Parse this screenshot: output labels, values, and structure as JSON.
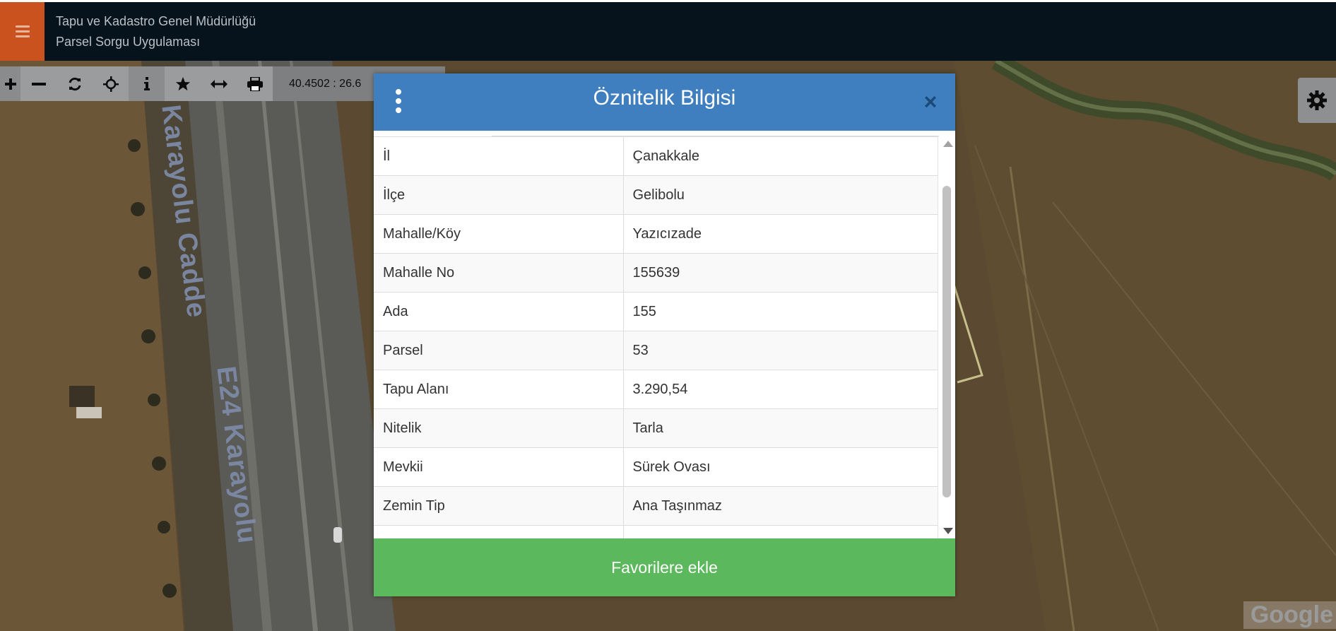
{
  "header": {
    "title_line1": "Tapu ve Kadastro Genel Müdürlüğü",
    "title_line2": "Parsel Sorgu Uygulaması"
  },
  "toolbar": {
    "coordinates": "40.4502 : 26.6",
    "buttons": [
      {
        "name": "zoom-in",
        "icon": "plus-icon"
      },
      {
        "name": "zoom-out",
        "icon": "minus-icon"
      },
      {
        "name": "refresh",
        "icon": "refresh-icon"
      },
      {
        "name": "locate",
        "icon": "crosshair-icon"
      },
      {
        "name": "info",
        "icon": "info-icon"
      },
      {
        "name": "favorite",
        "icon": "star-icon"
      },
      {
        "name": "measure",
        "icon": "arrows-horizontal-icon"
      },
      {
        "name": "print",
        "icon": "print-icon"
      }
    ]
  },
  "map": {
    "road_label_1": "Karayolu Cadde",
    "road_label_2": "E24 Karayolu",
    "attribution": "Google"
  },
  "modal": {
    "title": "Öznitelik Bilgisi",
    "close": "×",
    "rows": [
      {
        "key": "İl",
        "value": "Çanakkale"
      },
      {
        "key": "İlçe",
        "value": "Gelibolu"
      },
      {
        "key": "Mahalle/Köy",
        "value": "Yazıcızade"
      },
      {
        "key": "Mahalle No",
        "value": "155639"
      },
      {
        "key": "Ada",
        "value": "155"
      },
      {
        "key": "Parsel",
        "value": "53"
      },
      {
        "key": "Tapu Alanı",
        "value": "3.290,54"
      },
      {
        "key": "Nitelik",
        "value": "Tarla"
      },
      {
        "key": "Mevkii",
        "value": "Sürek Ovası"
      },
      {
        "key": "Zemin Tip",
        "value": "Ana Taşınmaz"
      }
    ],
    "button_label": "Favorilere ekle"
  },
  "colors": {
    "header_bg": "#06131c",
    "menu_bg": "#c9521f",
    "modal_header": "#3f7fbf",
    "button_green": "#5cb85c"
  }
}
